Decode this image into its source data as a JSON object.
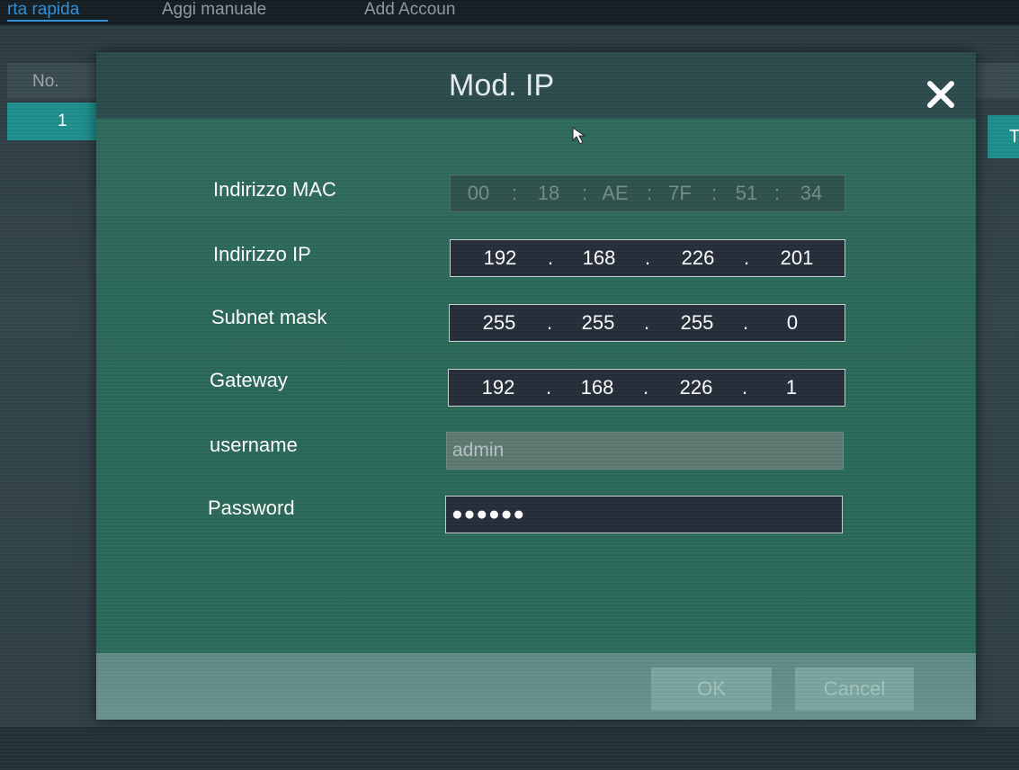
{
  "background": {
    "top_tabs": [
      "rta rapida",
      "Aggi manuale",
      "Add Accoun"
    ],
    "table_header_no": "No.",
    "selected_row": "1",
    "right_tab": "T"
  },
  "dialog": {
    "title": "Mod. IP",
    "close_icon": "close-icon",
    "fields": {
      "mac": {
        "label": "Indirizzo MAC",
        "parts": [
          "00",
          "18",
          "AE",
          "7F",
          "51",
          "34"
        ],
        "separator": ":"
      },
      "ip": {
        "label": "Indirizzo IP",
        "parts": [
          "192",
          "168",
          "226",
          "201"
        ],
        "separator": "."
      },
      "subnet": {
        "label": "Subnet mask",
        "parts": [
          "255",
          "255",
          "255",
          "0"
        ],
        "separator": "."
      },
      "gateway": {
        "label": "Gateway",
        "parts": [
          "192",
          "168",
          "226",
          "1"
        ],
        "separator": "."
      },
      "username": {
        "label": "username",
        "value": "admin"
      },
      "password": {
        "label": "Password",
        "value": "●●●●●●"
      }
    },
    "buttons": {
      "ok": "OK",
      "cancel": "Cancel"
    }
  },
  "colors": {
    "dialog_body": "#2a6857",
    "dialog_header": "#2c4a4c",
    "accent_teal": "#1f8f8d",
    "input_bg": "#252d3a"
  }
}
